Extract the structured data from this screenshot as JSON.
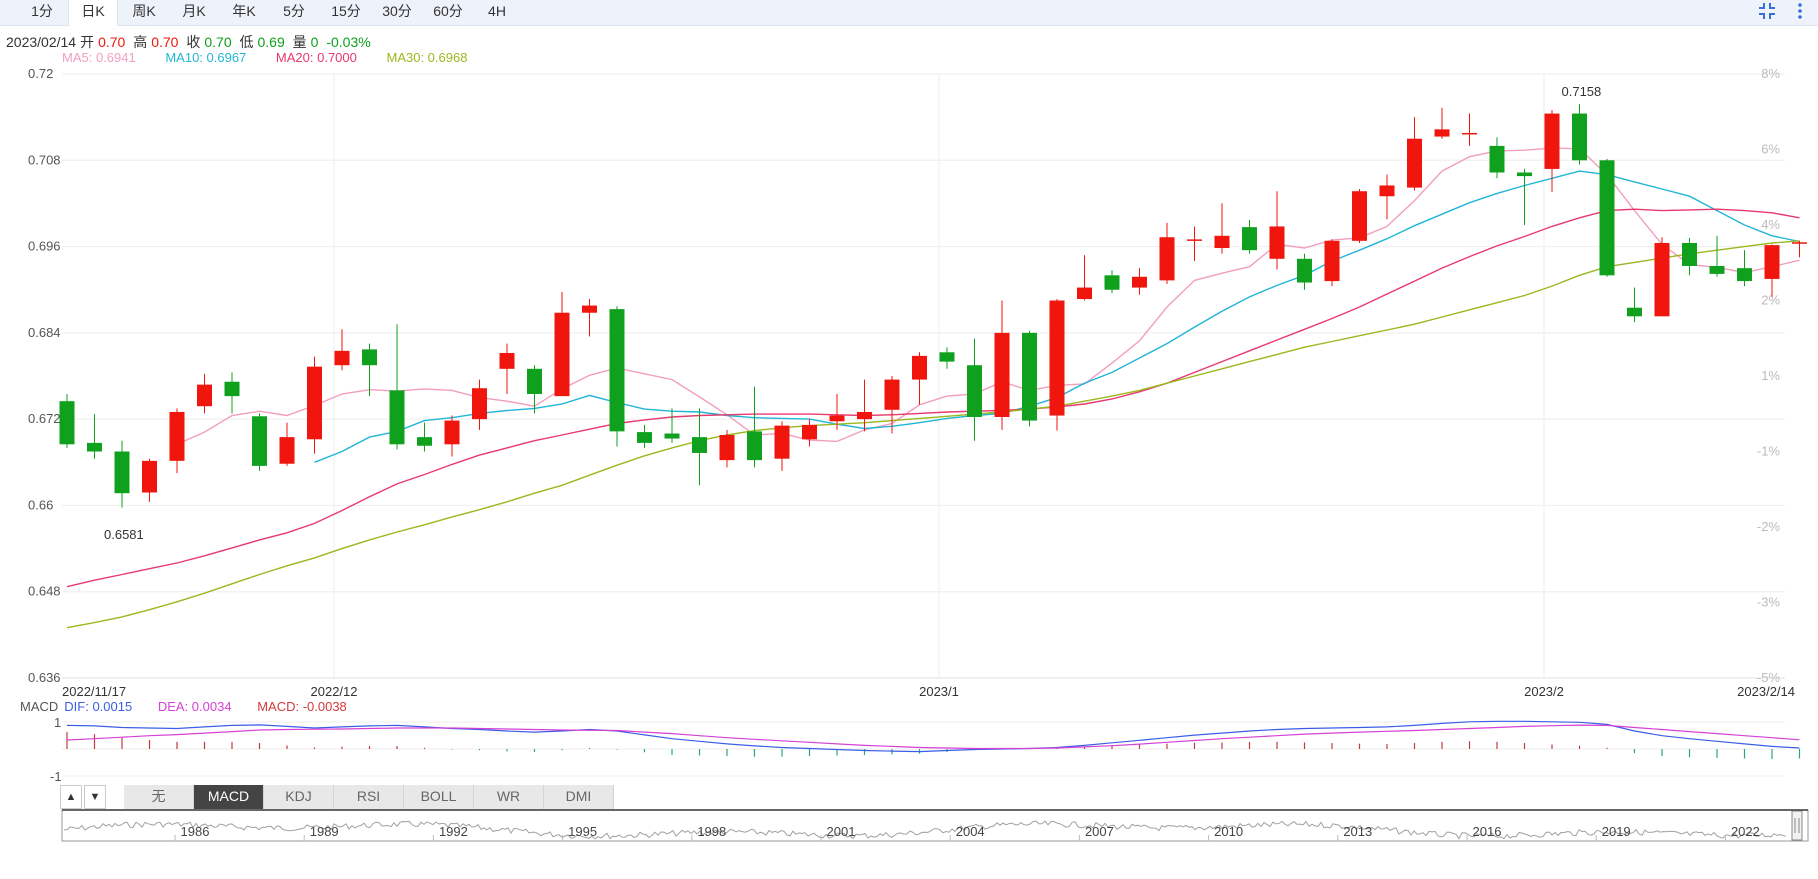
{
  "tabs": [
    "1分",
    "日K",
    "周K",
    "月K",
    "年K",
    "5分",
    "15分",
    "30分",
    "60分",
    "4H"
  ],
  "active_tab": 1,
  "corner_icons": [
    "collapse-icon",
    "more-vertical-icon"
  ],
  "info": {
    "date": "2023/02/14",
    "open_label": "开",
    "open": "0.70",
    "high_label": "高",
    "high": "0.70",
    "close_label": "收",
    "close": "0.70",
    "low_label": "低",
    "low": "0.69",
    "vol_label": "量",
    "vol": "0",
    "change": "-0.03%"
  },
  "ma_legend": [
    {
      "label": "MA5: 0.6941",
      "color": "#f29ec0"
    },
    {
      "label": "MA10: 0.6967",
      "color": "#22b5d6"
    },
    {
      "label": "MA20: 0.7000",
      "color": "#e8396d"
    },
    {
      "label": "MA30: 0.6968",
      "color": "#9ab81e"
    }
  ],
  "macd_legend": {
    "title": "MACD",
    "dif": "DIF: 0.0015",
    "dif_color": "#3b5ee6",
    "dea": "DEA: 0.0034",
    "dea_color": "#d641d6",
    "macd": "MACD: -0.0038",
    "macd_color": "#d13a3a"
  },
  "indicator_tabs": [
    "无",
    "MACD",
    "KDJ",
    "RSI",
    "BOLL",
    "WR",
    "DMI"
  ],
  "active_indicator": 1,
  "arrows": [
    "▲",
    "▼"
  ],
  "colors": {
    "up": "#f0150d",
    "down": "#0fa01e"
  },
  "chart_data": {
    "type": "candlestick",
    "ylim": [
      0.636,
      0.72
    ],
    "y_ticks": [
      "0.72",
      "0.708",
      "0.696",
      "0.684",
      "0.672",
      "0.66",
      "0.648",
      "0.636"
    ],
    "pct_ticks": [
      "8%",
      "6%",
      "4%",
      "2%",
      "1%",
      "-1%",
      "-2%",
      "-3%",
      "-5%"
    ],
    "x_labels": [
      {
        "text": "2022/11/17",
        "i": 0
      },
      {
        "text": "2022/12",
        "i": 10
      },
      {
        "text": "2023/1",
        "i": 32
      },
      {
        "text": "2023/2",
        "i": 54
      },
      {
        "text": "2023/2/14",
        "i": 63
      }
    ],
    "annotations": [
      {
        "text": "0.7158",
        "i": 55,
        "value": 0.7158
      },
      {
        "text": "0.6581",
        "i": 2,
        "value": 0.6581
      }
    ],
    "candles": [
      [
        0.6745,
        0.6685,
        0.6755,
        0.668
      ],
      [
        0.6687,
        0.6675,
        0.6727,
        0.6665
      ],
      [
        0.6675,
        0.6617,
        0.669,
        0.6597
      ],
      [
        0.6618,
        0.6662,
        0.6665,
        0.6605
      ],
      [
        0.6662,
        0.673,
        0.6735,
        0.6645
      ],
      [
        0.6738,
        0.6768,
        0.6783,
        0.6728
      ],
      [
        0.6772,
        0.6752,
        0.6785,
        0.6728
      ],
      [
        0.6724,
        0.6655,
        0.6728,
        0.6648
      ],
      [
        0.6658,
        0.6695,
        0.6715,
        0.6655
      ],
      [
        0.6692,
        0.6793,
        0.6807,
        0.6672
      ],
      [
        0.6795,
        0.6815,
        0.6845,
        0.6788
      ],
      [
        0.6817,
        0.6795,
        0.6825,
        0.6752
      ],
      [
        0.676,
        0.6685,
        0.6852,
        0.6678
      ],
      [
        0.6695,
        0.6683,
        0.6715,
        0.6675
      ],
      [
        0.6685,
        0.6718,
        0.6725,
        0.6668
      ],
      [
        0.672,
        0.6763,
        0.6775,
        0.6705
      ],
      [
        0.679,
        0.6812,
        0.6825,
        0.6755
      ],
      [
        0.679,
        0.6755,
        0.6795,
        0.6728
      ],
      [
        0.6752,
        0.6868,
        0.6897,
        0.6752
      ],
      [
        0.6868,
        0.6878,
        0.6887,
        0.6835
      ],
      [
        0.6873,
        0.6703,
        0.6877,
        0.6682
      ],
      [
        0.6702,
        0.6687,
        0.6712,
        0.668
      ],
      [
        0.67,
        0.6693,
        0.6735,
        0.6687
      ],
      [
        0.6695,
        0.6673,
        0.6735,
        0.6628
      ],
      [
        0.6663,
        0.6698,
        0.6705,
        0.6653
      ],
      [
        0.6703,
        0.6663,
        0.6765,
        0.6653
      ],
      [
        0.6665,
        0.6711,
        0.6717,
        0.6648
      ],
      [
        0.6692,
        0.6712,
        0.672,
        0.6682
      ],
      [
        0.6717,
        0.6725,
        0.6755,
        0.6705
      ],
      [
        0.672,
        0.673,
        0.6775,
        0.6703
      ],
      [
        0.6733,
        0.6775,
        0.678,
        0.67
      ],
      [
        0.6775,
        0.6808,
        0.6813,
        0.674
      ],
      [
        0.6813,
        0.68,
        0.682,
        0.679
      ],
      [
        0.6795,
        0.6723,
        0.6832,
        0.669
      ],
      [
        0.6723,
        0.684,
        0.6885,
        0.6705
      ],
      [
        0.684,
        0.6718,
        0.6843,
        0.671
      ],
      [
        0.6725,
        0.6885,
        0.6887,
        0.6704
      ],
      [
        0.6887,
        0.6903,
        0.6948,
        0.6885
      ],
      [
        0.692,
        0.69,
        0.6927,
        0.6895
      ],
      [
        0.6903,
        0.6918,
        0.693,
        0.6893
      ],
      [
        0.6913,
        0.6973,
        0.6993,
        0.6908
      ],
      [
        0.6969,
        0.697,
        0.6988,
        0.694
      ],
      [
        0.6958,
        0.6975,
        0.702,
        0.695
      ],
      [
        0.6987,
        0.6955,
        0.6997,
        0.695
      ],
      [
        0.6943,
        0.6988,
        0.7037,
        0.6928
      ],
      [
        0.6943,
        0.691,
        0.695,
        0.69
      ],
      [
        0.6912,
        0.6968,
        0.697,
        0.6905
      ],
      [
        0.6968,
        0.7037,
        0.704,
        0.6965
      ],
      [
        0.703,
        0.7045,
        0.706,
        0.6998
      ],
      [
        0.7042,
        0.711,
        0.714,
        0.7038
      ],
      [
        0.7113,
        0.7123,
        0.7153,
        0.711
      ],
      [
        0.7118,
        0.7118,
        0.7145,
        0.71
      ],
      [
        0.71,
        0.7063,
        0.7112,
        0.7055
      ],
      [
        0.7063,
        0.7058,
        0.7068,
        0.699
      ],
      [
        0.7068,
        0.7145,
        0.715,
        0.7036
      ],
      [
        0.7145,
        0.708,
        0.7158,
        0.7074
      ],
      [
        0.708,
        0.692,
        0.7082,
        0.6918
      ],
      [
        0.6875,
        0.6863,
        0.6903,
        0.6855
      ],
      [
        0.6863,
        0.6965,
        0.6973,
        0.6863
      ],
      [
        0.6965,
        0.6933,
        0.6972,
        0.692
      ],
      [
        0.6933,
        0.6922,
        0.6975,
        0.6918
      ],
      [
        0.693,
        0.6912,
        0.6955,
        0.6905
      ],
      [
        0.6915,
        0.6962,
        0.6963,
        0.689
      ],
      [
        0.6965,
        0.6966,
        0.6968,
        0.6945
      ]
    ],
    "ma_series": [
      {
        "name": "MA5",
        "color": "#f29ec0",
        "values": [
          null,
          null,
          null,
          null,
          0.6685,
          0.6702,
          0.6725,
          0.6731,
          0.6725,
          0.6739,
          0.6755,
          0.6761,
          0.6759,
          0.6762,
          0.676,
          0.675,
          0.6745,
          0.6738,
          0.6762,
          0.6781,
          0.6791,
          0.6783,
          0.6775,
          0.6751,
          0.6726,
          0.6698,
          0.67,
          0.6691,
          0.6689,
          0.6705,
          0.6714,
          0.674,
          0.6752,
          0.6755,
          0.6772,
          0.676,
          0.6767,
          0.6769,
          0.6798,
          0.6829,
          0.6876,
          0.6913,
          0.6923,
          0.6932,
          0.6963,
          0.6958,
          0.6969,
          0.6972,
          0.6988,
          0.7024,
          0.7065,
          0.7085,
          0.7093,
          0.7094,
          0.7097,
          0.7096,
          0.706,
          0.701,
          0.6963,
          0.6935,
          0.6931,
          0.6924,
          0.6932,
          0.6941
        ]
      },
      {
        "name": "MA10",
        "color": "#22b5d6",
        "values": [
          null,
          null,
          null,
          null,
          null,
          null,
          null,
          null,
          null,
          0.666,
          0.6675,
          0.6695,
          0.6703,
          0.6718,
          0.6722,
          0.6728,
          0.6732,
          0.6735,
          0.6741,
          0.6753,
          0.6743,
          0.6734,
          0.6731,
          0.673,
          0.6725,
          0.6722,
          0.6721,
          0.672,
          0.6713,
          0.6707,
          0.671,
          0.6715,
          0.6721,
          0.6725,
          0.6728,
          0.6738,
          0.675,
          0.677,
          0.6785,
          0.6805,
          0.6825,
          0.6848,
          0.687,
          0.689,
          0.6906,
          0.692,
          0.694,
          0.6955,
          0.6971,
          0.6989,
          0.7005,
          0.7021,
          0.7034,
          0.7045,
          0.7055,
          0.7065,
          0.706,
          0.705,
          0.704,
          0.703,
          0.701,
          0.699,
          0.6975,
          0.6967
        ]
      },
      {
        "name": "MA20",
        "color": "#e8396d",
        "values": [
          0.6487,
          0.6496,
          0.6504,
          0.6512,
          0.652,
          0.653,
          0.6541,
          0.6552,
          0.6562,
          0.6575,
          0.6593,
          0.6612,
          0.663,
          0.6643,
          0.6657,
          0.667,
          0.668,
          0.669,
          0.6698,
          0.6706,
          0.6714,
          0.6719,
          0.6723,
          0.6725,
          0.6726,
          0.6727,
          0.6727,
          0.6727,
          0.6726,
          0.6725,
          0.6726,
          0.6728,
          0.673,
          0.6731,
          0.6732,
          0.6734,
          0.6737,
          0.6741,
          0.6748,
          0.6758,
          0.677,
          0.6785,
          0.68,
          0.6815,
          0.683,
          0.6845,
          0.686,
          0.6876,
          0.6894,
          0.6912,
          0.693,
          0.6946,
          0.6961,
          0.6974,
          0.6988,
          0.7,
          0.701,
          0.7012,
          0.701,
          0.7011,
          0.7012,
          0.701,
          0.7007,
          0.7
        ]
      },
      {
        "name": "MA30",
        "color": "#9ab81e",
        "values": [
          0.643,
          0.6437,
          0.6445,
          0.6455,
          0.6466,
          0.6478,
          0.6491,
          0.6504,
          0.6516,
          0.6527,
          0.654,
          0.6552,
          0.6563,
          0.6573,
          0.6584,
          0.6594,
          0.6605,
          0.6617,
          0.6628,
          0.6642,
          0.6656,
          0.6669,
          0.668,
          0.669,
          0.6698,
          0.6704,
          0.6708,
          0.6711,
          0.6713,
          0.6715,
          0.6718,
          0.6721,
          0.6724,
          0.6727,
          0.673,
          0.6734,
          0.6738,
          0.6745,
          0.6752,
          0.676,
          0.677,
          0.678,
          0.679,
          0.68,
          0.681,
          0.682,
          0.6828,
          0.6836,
          0.6844,
          0.6852,
          0.6862,
          0.6872,
          0.6882,
          0.6892,
          0.6905,
          0.692,
          0.6932,
          0.6938,
          0.6944,
          0.695,
          0.6955,
          0.696,
          0.6965,
          0.6968
        ]
      }
    ],
    "macd_chart": {
      "ylim": [
        -1.0,
        1.0
      ],
      "y_ticks": [
        "1",
        "-1"
      ],
      "dif": [
        0.92,
        0.9,
        0.84,
        0.82,
        0.8,
        0.86,
        0.92,
        0.94,
        0.88,
        0.82,
        0.86,
        0.9,
        0.92,
        0.86,
        0.8,
        0.76,
        0.7,
        0.66,
        0.7,
        0.76,
        0.7,
        0.55,
        0.4,
        0.3,
        0.2,
        0.12,
        0.06,
        0.02,
        -0.02,
        -0.06,
        -0.08,
        -0.1,
        -0.06,
        -0.02,
        0.0,
        0.02,
        0.06,
        0.14,
        0.24,
        0.34,
        0.44,
        0.54,
        0.62,
        0.7,
        0.76,
        0.8,
        0.82,
        0.84,
        0.86,
        0.92,
        1.0,
        1.06,
        1.08,
        1.08,
        1.06,
        1.04,
        0.96,
        0.7,
        0.52,
        0.4,
        0.3,
        0.2,
        0.1,
        0.04
      ],
      "dea": [
        0.35,
        0.4,
        0.46,
        0.52,
        0.56,
        0.62,
        0.68,
        0.74,
        0.76,
        0.77,
        0.78,
        0.8,
        0.82,
        0.82,
        0.82,
        0.8,
        0.78,
        0.76,
        0.74,
        0.73,
        0.72,
        0.66,
        0.6,
        0.52,
        0.44,
        0.38,
        0.32,
        0.26,
        0.2,
        0.14,
        0.1,
        0.06,
        0.04,
        0.02,
        0.02,
        0.02,
        0.04,
        0.08,
        0.13,
        0.19,
        0.26,
        0.33,
        0.4,
        0.46,
        0.52,
        0.58,
        0.62,
        0.66,
        0.69,
        0.72,
        0.76,
        0.8,
        0.84,
        0.88,
        0.91,
        0.93,
        0.92,
        0.84,
        0.76,
        0.68,
        0.6,
        0.52,
        0.44,
        0.36
      ],
      "bar_value_ticks": true
    },
    "navigator": {
      "year_labels": [
        "1986",
        "1989",
        "1992",
        "1995",
        "1998",
        "2001",
        "2004",
        "2007",
        "2010",
        "2013",
        "2016",
        "2019",
        "2022"
      ]
    }
  }
}
